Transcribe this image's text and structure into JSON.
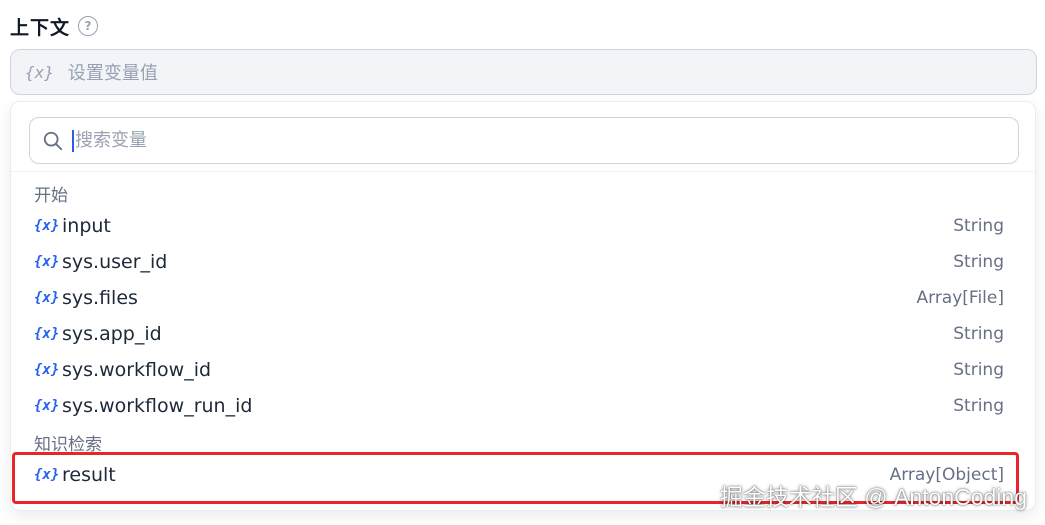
{
  "context": {
    "title": "上下文",
    "help_glyph": "?"
  },
  "var_field": {
    "icon_text": "{x}",
    "placeholder": "设置变量值"
  },
  "search": {
    "placeholder": "搜索变量"
  },
  "groups": [
    {
      "title": "开始",
      "items": [
        {
          "icon": "{x}",
          "name": "input",
          "type": "String"
        },
        {
          "icon": "{x}",
          "name": "sys.user_id",
          "type": "String"
        },
        {
          "icon": "{x}",
          "name": "sys.files",
          "type": "Array[File]"
        },
        {
          "icon": "{x}",
          "name": "sys.app_id",
          "type": "String"
        },
        {
          "icon": "{x}",
          "name": "sys.workflow_id",
          "type": "String"
        },
        {
          "icon": "{x}",
          "name": "sys.workflow_run_id",
          "type": "String"
        }
      ]
    },
    {
      "title": "知识检索",
      "items": [
        {
          "icon": "{x}",
          "name": "result",
          "type": "Array[Object]"
        }
      ]
    }
  ],
  "watermark": "掘金技术社区 @ AntonCoding",
  "colors": {
    "accent": "#2563eb",
    "highlight": "#e8262a"
  }
}
